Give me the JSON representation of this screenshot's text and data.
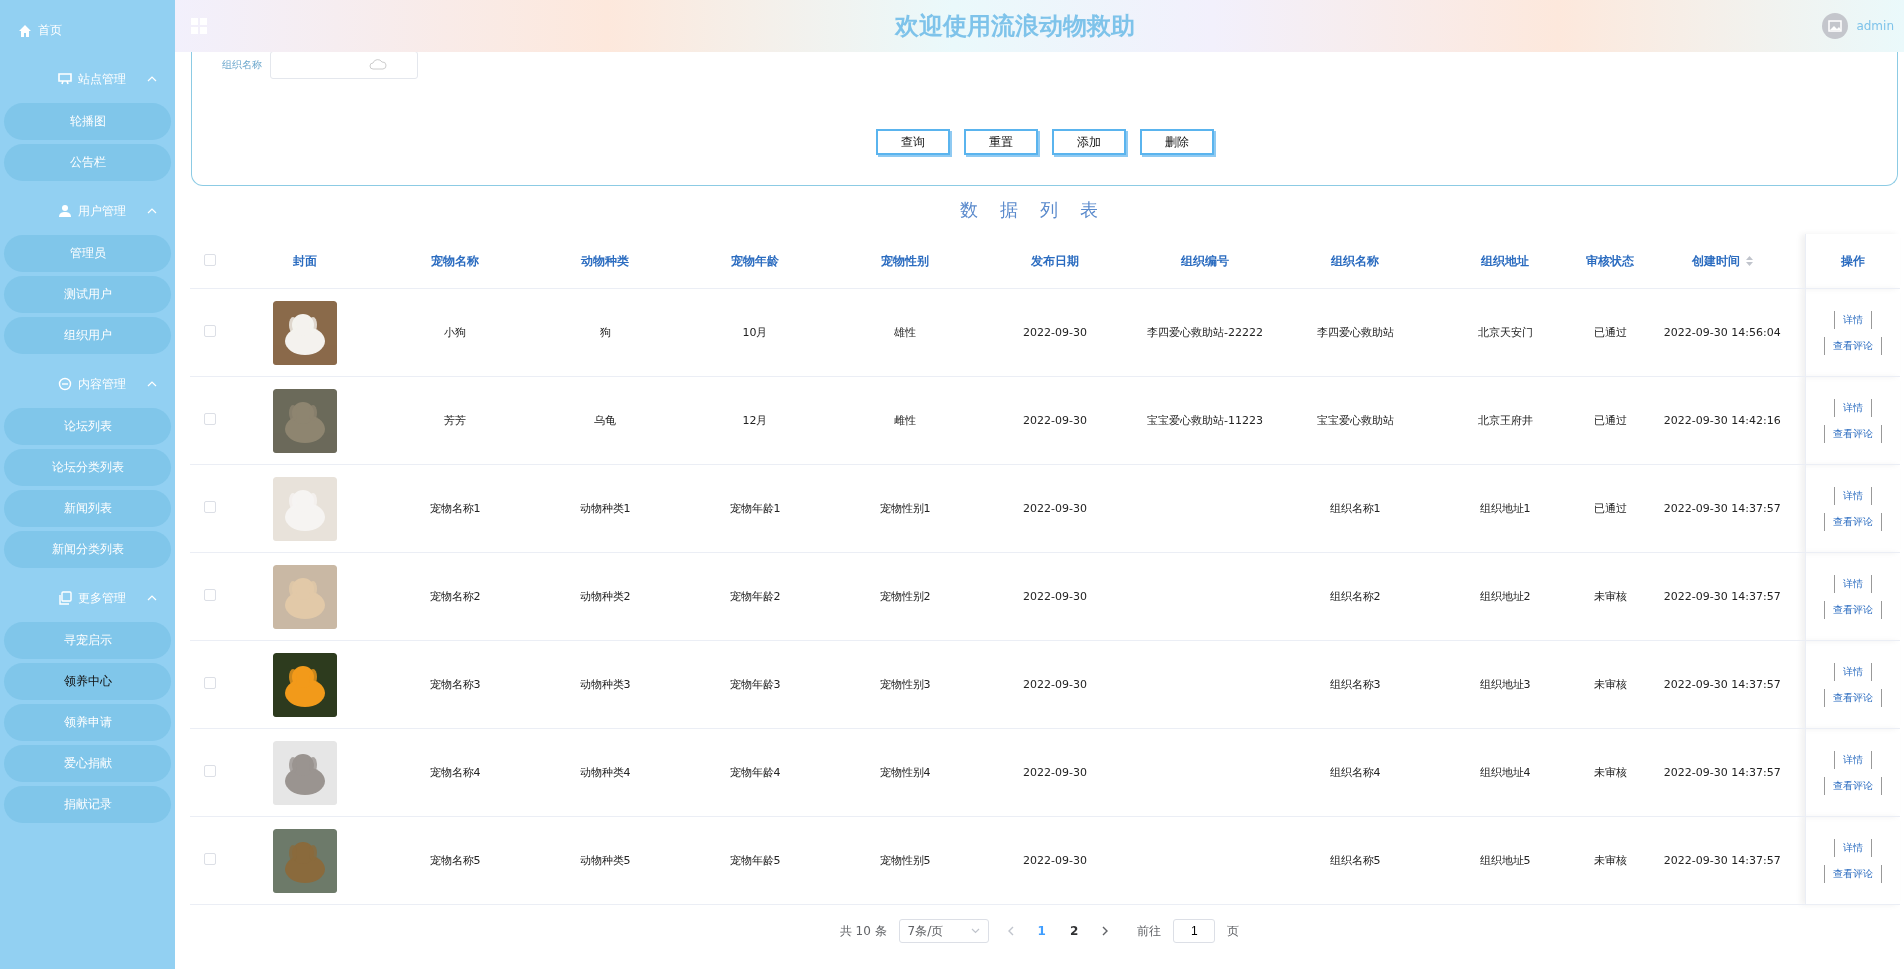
{
  "sidebar": {
    "home": {
      "label": "首页"
    },
    "groups": [
      {
        "label": "站点管理",
        "expanded": true,
        "items": [
          {
            "label": "轮播图",
            "selected": false
          },
          {
            "label": "公告栏",
            "selected": false
          }
        ]
      },
      {
        "label": "用户管理",
        "expanded": true,
        "items": [
          {
            "label": "管理员",
            "selected": false
          },
          {
            "label": "测试用户",
            "selected": false
          },
          {
            "label": "组织用户",
            "selected": false
          }
        ]
      },
      {
        "label": "内容管理",
        "expanded": true,
        "items": [
          {
            "label": "论坛列表",
            "selected": false
          },
          {
            "label": "论坛分类列表",
            "selected": false
          },
          {
            "label": "新闻列表",
            "selected": false
          },
          {
            "label": "新闻分类列表",
            "selected": false
          }
        ]
      },
      {
        "label": "更多管理",
        "expanded": true,
        "items": [
          {
            "label": "寻宠启示",
            "selected": false
          },
          {
            "label": "领养中心",
            "selected": true
          },
          {
            "label": "领养申请",
            "selected": false
          },
          {
            "label": "爱心捐献",
            "selected": false
          },
          {
            "label": "捐献记录",
            "selected": false
          }
        ]
      }
    ]
  },
  "header": {
    "title": "欢迎使用流浪动物救助",
    "user": "admin"
  },
  "search": {
    "label": "组织名称",
    "buttons": [
      "查询",
      "重置",
      "添加",
      "删除"
    ]
  },
  "list_title": "数据列表",
  "table": {
    "select_all": {
      "checked": false
    },
    "columns": [
      {
        "label": "封面",
        "sortable": false
      },
      {
        "label": "宠物名称",
        "sortable": false
      },
      {
        "label": "动物种类",
        "sortable": false
      },
      {
        "label": "宠物年龄",
        "sortable": false
      },
      {
        "label": "宠物性别",
        "sortable": false
      },
      {
        "label": "发布日期",
        "sortable": false
      },
      {
        "label": "组织编号",
        "sortable": false
      },
      {
        "label": "组织名称",
        "sortable": false
      },
      {
        "label": "组织地址",
        "sortable": false
      },
      {
        "label": "审核状态",
        "sortable": false
      },
      {
        "label": "创建时间",
        "sortable": true
      },
      {
        "label": "操作",
        "sortable": false
      }
    ],
    "rows": [
      {
        "checked": false,
        "cells": [
          {
            "kind": "picture"
          },
          "小狗",
          "狗",
          "10月",
          "雄性",
          "2022-09-30",
          "李四爱心救助站-22222",
          "李四爱心救助站",
          "北京天安门",
          "已通过",
          "2022-09-30 14:56:04",
          {
            "kind": "actions",
            "labels": [
              "详情",
              "查看评论"
            ]
          }
        ]
      },
      {
        "checked": false,
        "cells": [
          {
            "kind": "picture"
          },
          "芳芳",
          "乌龟",
          "12月",
          "雌性",
          "2022-09-30",
          "宝宝爱心救助站-11223",
          "宝宝爱心救助站",
          "北京王府井",
          "已通过",
          "2022-09-30 14:42:16",
          {
            "kind": "actions",
            "labels": [
              "详情",
              "查看评论"
            ]
          }
        ]
      },
      {
        "checked": false,
        "cells": [
          {
            "kind": "picture"
          },
          "宠物名称1",
          "动物种类1",
          "宠物年龄1",
          "宠物性别1",
          "2022-09-30",
          null,
          "组织名称1",
          "组织地址1",
          "已通过",
          "2022-09-30 14:37:57",
          {
            "kind": "actions",
            "labels": [
              "详情",
              "查看评论"
            ]
          }
        ]
      },
      {
        "checked": false,
        "cells": [
          {
            "kind": "picture"
          },
          "宠物名称2",
          "动物种类2",
          "宠物年龄2",
          "宠物性别2",
          "2022-09-30",
          null,
          "组织名称2",
          "组织地址2",
          "未审核",
          "2022-09-30 14:37:57",
          {
            "kind": "actions",
            "labels": [
              "详情",
              "查看评论"
            ]
          }
        ]
      },
      {
        "checked": false,
        "cells": [
          {
            "kind": "picture"
          },
          "宠物名称3",
          "动物种类3",
          "宠物年龄3",
          "宠物性别3",
          "2022-09-30",
          null,
          "组织名称3",
          "组织地址3",
          "未审核",
          "2022-09-30 14:37:57",
          {
            "kind": "actions",
            "labels": [
              "详情",
              "查看评论"
            ]
          }
        ]
      },
      {
        "checked": false,
        "cells": [
          {
            "kind": "picture"
          },
          "宠物名称4",
          "动物种类4",
          "宠物年龄4",
          "宠物性别4",
          "2022-09-30",
          null,
          "组织名称4",
          "组织地址4",
          "未审核",
          "2022-09-30 14:37:57",
          {
            "kind": "actions",
            "labels": [
              "详情",
              "查看评论"
            ]
          }
        ]
      },
      {
        "checked": false,
        "cells": [
          {
            "kind": "picture"
          },
          "宠物名称5",
          "动物种类5",
          "宠物年龄5",
          "宠物性别5",
          "2022-09-30",
          null,
          "组织名称5",
          "组织地址5",
          "未审核",
          "2022-09-30 14:37:57",
          {
            "kind": "actions",
            "labels": [
              "详情",
              "查看评论"
            ]
          }
        ]
      }
    ]
  },
  "pagination": {
    "total": "共 10 条",
    "page_size": "7条/页",
    "pages": [
      {
        "label": "1",
        "selected": true
      },
      {
        "label": "2",
        "selected": false
      }
    ],
    "goto_label": "前往",
    "goto_value": "1",
    "goto_suffix": "页"
  }
}
